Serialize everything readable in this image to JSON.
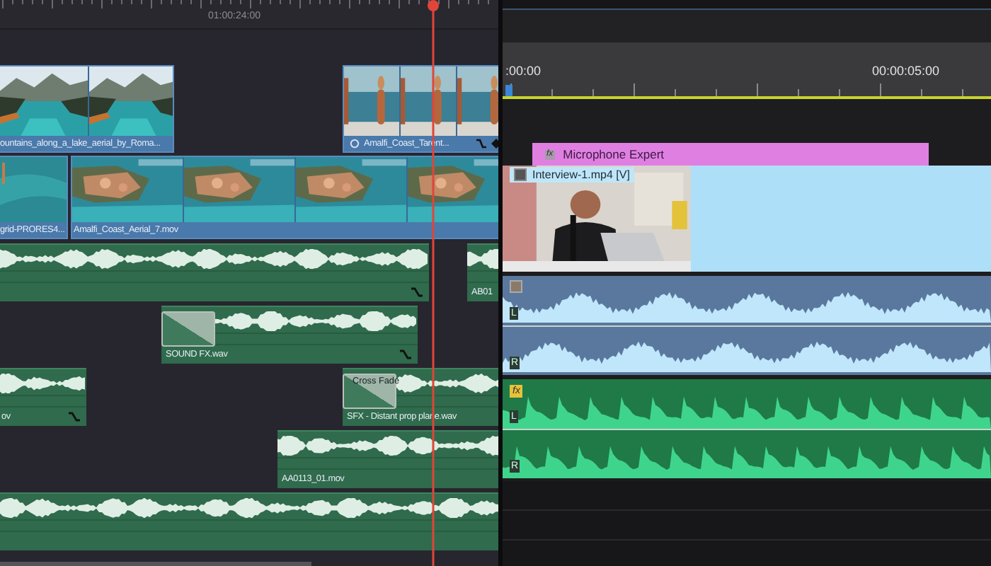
{
  "left_timeline": {
    "ruler": {
      "timecode": "01:00:24:00"
    },
    "video_tracks": [
      {
        "clips": [
          {
            "label": "ountains_along_a_lake_aerial_by_Roma...",
            "icons": false
          },
          {
            "label": "Amalfi_Coast_Tarent...",
            "icons": true
          }
        ]
      },
      {
        "clips": [
          {
            "label": "grid-PRORES4...",
            "icons": false
          },
          {
            "label": "Amalfi_Coast_Aerial_7.mov",
            "icons": false
          }
        ]
      }
    ],
    "audio_tracks": [
      {
        "clips": [
          {
            "curve_icon": true,
            "fade_box": false
          },
          {
            "label": "AB01",
            "curve_icon": false,
            "fade_box": false
          }
        ]
      },
      {
        "clips": [
          {
            "label": "SOUND FX.wav",
            "curve_icon": true,
            "fade_box": true
          }
        ]
      },
      {
        "clips": [
          {
            "label": "ov",
            "curve_icon": true,
            "fade_box": false
          },
          {
            "label": "SFX - Distant prop plane.wav",
            "curve_icon": false,
            "fade_box": true,
            "fade_label": "Cross Fade"
          }
        ]
      },
      {
        "clips": [
          {
            "label": "AA0113_01.mov",
            "curve_icon": false,
            "fade_box": false
          }
        ]
      },
      {
        "clips": [
          {
            "curve_icon": false,
            "fade_box": false
          }
        ]
      }
    ]
  },
  "right_timeline": {
    "ruler": {
      "start": ":00:00",
      "mark": "00:00:05:00"
    },
    "effect_clip": {
      "badge": "fx",
      "label": "Microphone Expert"
    },
    "video_clip": {
      "label": "Interview-1.mp4 [V]"
    },
    "audio_clips": [
      {
        "kind": "linked",
        "channels": [
          "L",
          "R"
        ]
      },
      {
        "kind": "effect",
        "badge": "fx",
        "channels": [
          "L",
          "R"
        ]
      }
    ]
  }
}
